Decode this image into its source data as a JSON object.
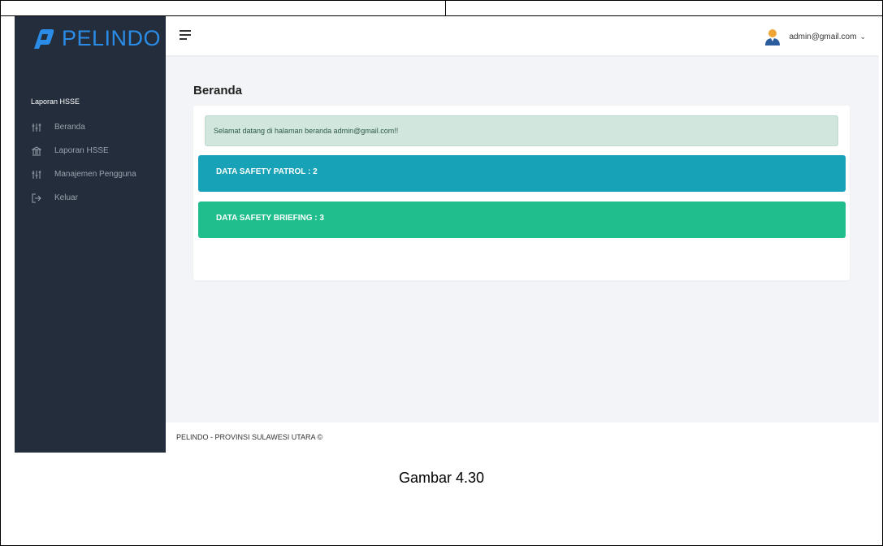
{
  "brand": {
    "name": "PELINDO",
    "accent_color": "#2a8ce6"
  },
  "sidebar": {
    "section_header": "Laporan HSSE",
    "items": [
      {
        "label": "Beranda",
        "icon": "sliders-icon"
      },
      {
        "label": "Laporan HSSE",
        "icon": "building-columns-icon"
      },
      {
        "label": "Manajemen Pengguna",
        "icon": "sliders-icon"
      },
      {
        "label": "Keluar",
        "icon": "logout-icon"
      }
    ],
    "background": "#232d3b"
  },
  "topbar": {
    "user_email": "admin@gmail.com",
    "chevron": "⌄"
  },
  "main": {
    "title": "Beranda",
    "welcome_message": "Selamat datang di halaman beranda admin@gmail.com!!",
    "stats": [
      {
        "label": "DATA SAFETY PATROL : 2",
        "color": "#18a2b8"
      },
      {
        "label": "DATA SAFETY BRIEFING : 3",
        "color": "#1fbe8c"
      }
    ]
  },
  "footer": {
    "text": "PELINDO - PROVINSI SULAWESI UTARA ©"
  },
  "caption": "Gambar 4.30"
}
